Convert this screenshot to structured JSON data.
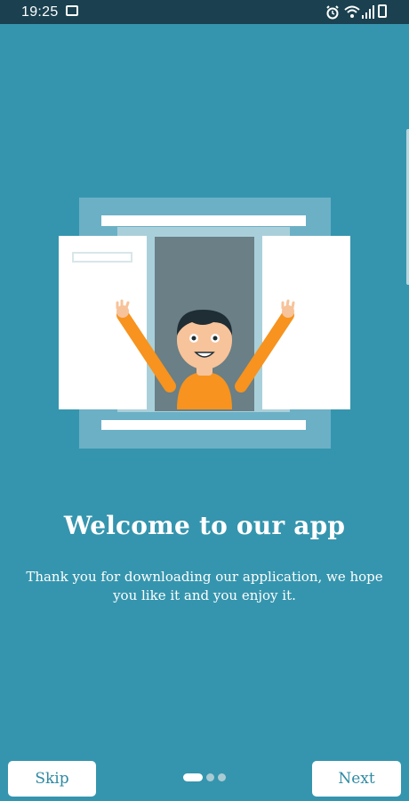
{
  "status_bar": {
    "time": "19:25",
    "icons": [
      "message-icon",
      "alarm-icon",
      "wifi-icon",
      "signal-icon",
      "battery-charging-icon"
    ]
  },
  "onboarding": {
    "title": "Welcome to our app",
    "subtitle": "Thank you for downloading our application, we hope you like it and you enjoy it.",
    "illustration": "person-waving-from-window",
    "page_count": 3,
    "current_page": 1
  },
  "footer": {
    "skip_label": "Skip",
    "next_label": "Next"
  },
  "colors": {
    "background": "#3595ae",
    "status_bar": "#1b4150",
    "button_text": "#2e8aa3",
    "accent_orange": "#f7931e"
  }
}
